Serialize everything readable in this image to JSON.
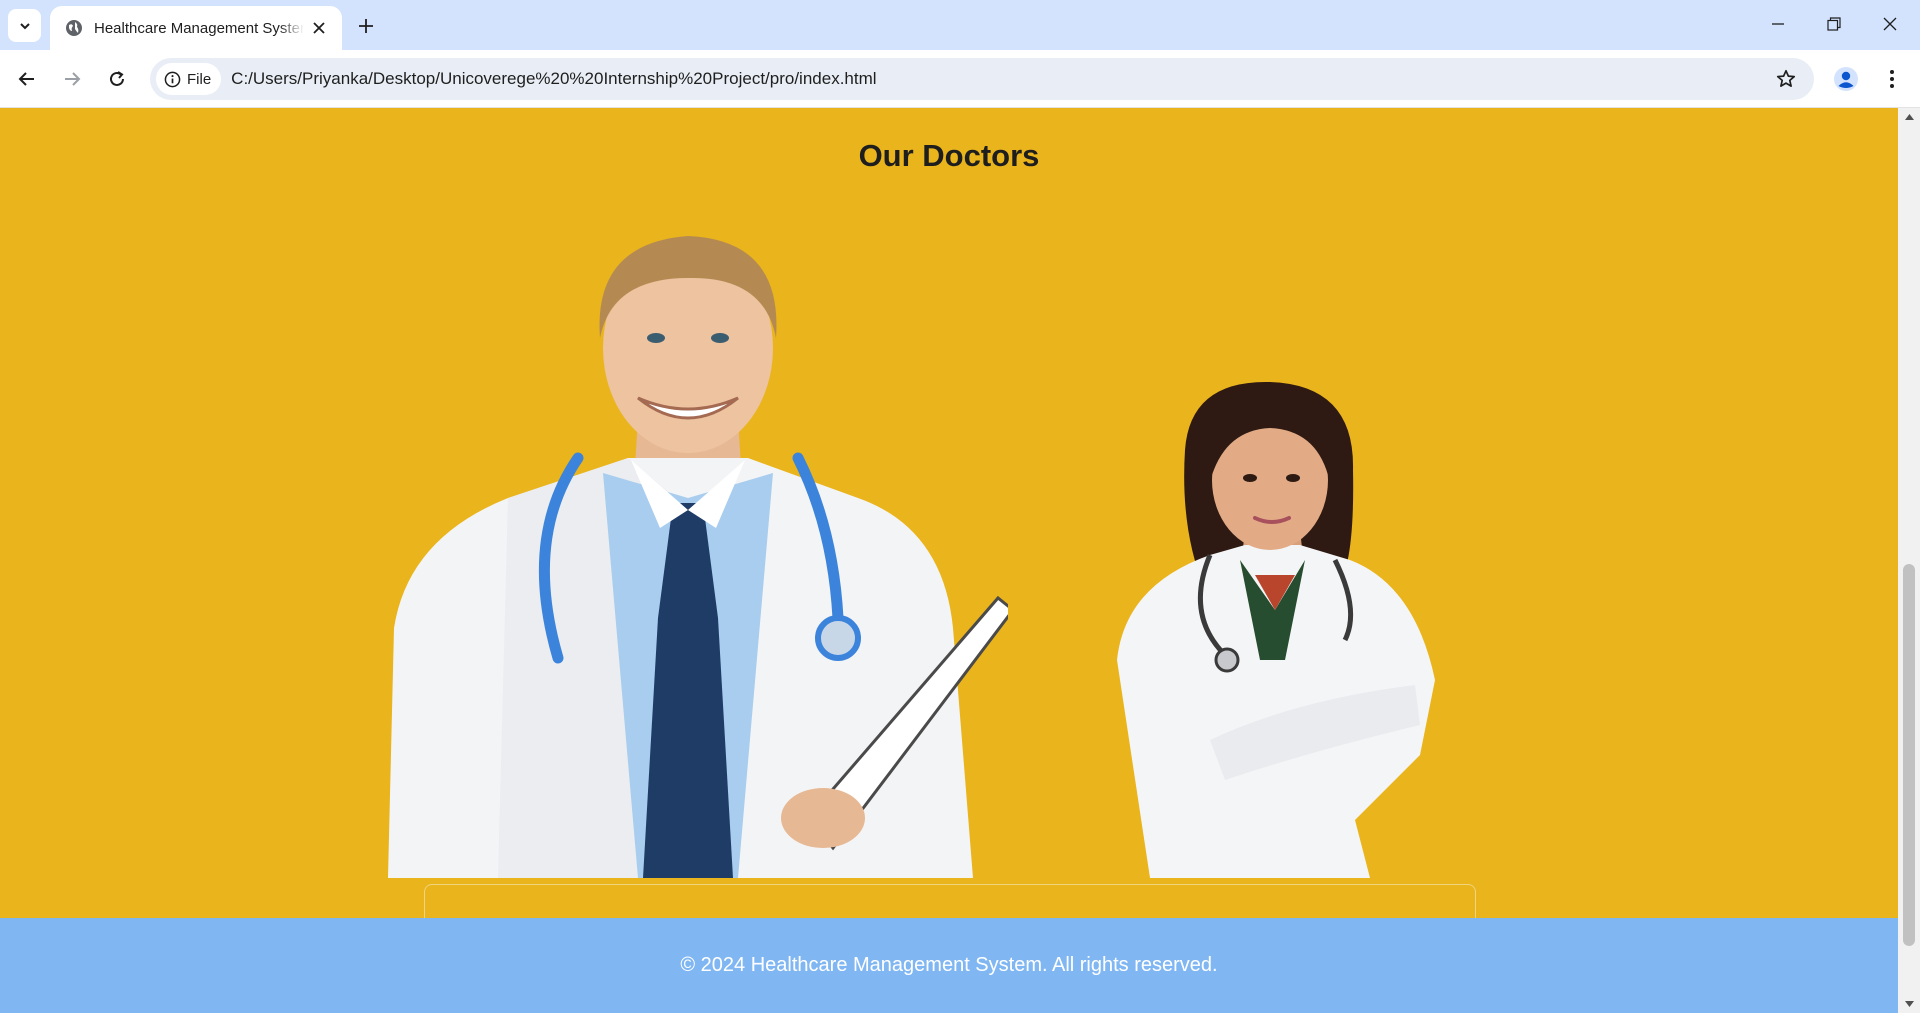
{
  "browser": {
    "tab": {
      "title": "Healthcare Management System",
      "favicon": "globe-icon",
      "close": "close-icon"
    },
    "new_tab": "plus-icon",
    "window_controls": [
      "minimize-icon",
      "restore-icon",
      "close-icon"
    ],
    "toolbar": {
      "back": "back-arrow-icon",
      "forward": "forward-arrow-icon",
      "reload": "reload-icon",
      "site_chip_label": "File",
      "url": "C:/Users/Priyanka/Desktop/Unicoverege%20%20Internship%20Project/pro/index.html",
      "bookmark": "star-icon",
      "profile": "profile-icon",
      "menu": "kebab-menu-icon"
    }
  },
  "page": {
    "doctors_section": {
      "title": "Our Doctors",
      "background": "#eab41d",
      "doctors": [
        {
          "image": "male-doctor-photo"
        },
        {
          "image": "female-doctor-photo"
        }
      ]
    },
    "footer": {
      "text": "© 2024 Healthcare Management System. All rights reserved.",
      "background": "#80b7f3"
    }
  },
  "colors": {
    "tabstrip": "#d3e3fd",
    "omnibox": "#e9eef6",
    "accent": "#0b57d0"
  }
}
